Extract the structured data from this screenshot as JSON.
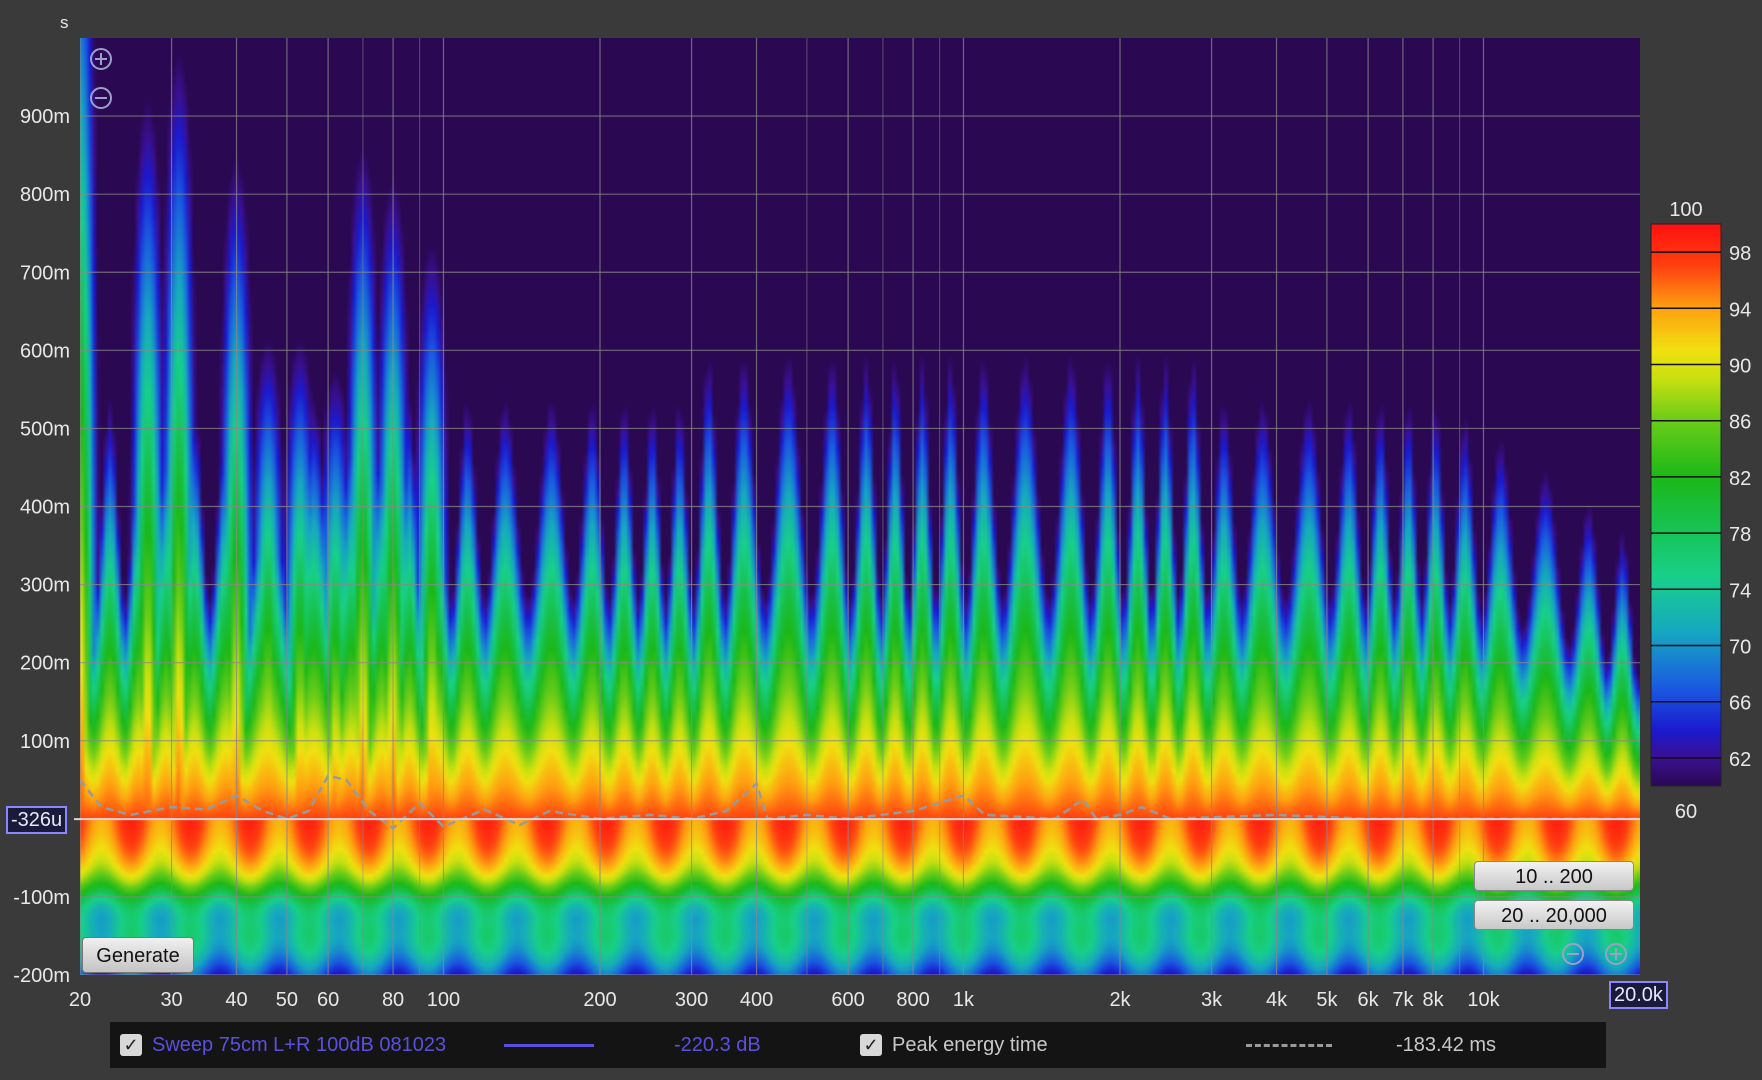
{
  "chart_data": {
    "type": "heatmap",
    "title": "",
    "xlabel": "",
    "ylabel": "s",
    "x_scale": "log",
    "x_range": [
      20,
      20000
    ],
    "y_range": [
      -0.2,
      1.0
    ],
    "x_ticks": [
      {
        "v": 20,
        "label": "20"
      },
      {
        "v": 30,
        "label": "30"
      },
      {
        "v": 40,
        "label": "40"
      },
      {
        "v": 50,
        "label": "50"
      },
      {
        "v": 60,
        "label": "60"
      },
      {
        "v": 80,
        "label": "80"
      },
      {
        "v": 100,
        "label": "100"
      },
      {
        "v": 200,
        "label": "200"
      },
      {
        "v": 300,
        "label": "300"
      },
      {
        "v": 400,
        "label": "400"
      },
      {
        "v": 600,
        "label": "600"
      },
      {
        "v": 800,
        "label": "800"
      },
      {
        "v": 1000,
        "label": "1k"
      },
      {
        "v": 2000,
        "label": "2k"
      },
      {
        "v": 3000,
        "label": "3k"
      },
      {
        "v": 4000,
        "label": "4k"
      },
      {
        "v": 5000,
        "label": "5k"
      },
      {
        "v": 6000,
        "label": "6k"
      },
      {
        "v": 7000,
        "label": "7k"
      },
      {
        "v": 8000,
        "label": "8k"
      },
      {
        "v": 10000,
        "label": "10k"
      }
    ],
    "x_minor_grid": [
      70,
      90,
      500,
      700,
      900,
      9000
    ],
    "x_end_label": "20.0k",
    "y_ticks": [
      {
        "v": 0.9,
        "label": "900m"
      },
      {
        "v": 0.8,
        "label": "800m"
      },
      {
        "v": 0.7,
        "label": "700m"
      },
      {
        "v": 0.6,
        "label": "600m"
      },
      {
        "v": 0.5,
        "label": "500m"
      },
      {
        "v": 0.4,
        "label": "400m"
      },
      {
        "v": 0.3,
        "label": "300m"
      },
      {
        "v": 0.2,
        "label": "200m"
      },
      {
        "v": 0.1,
        "label": "100m"
      },
      {
        "v": -0.1,
        "label": "-100m"
      },
      {
        "v": -0.2,
        "label": "-200m"
      }
    ],
    "cursor": {
      "y": -0.000326,
      "label": "-326u"
    },
    "colorscale": {
      "min": 60,
      "max": 100,
      "min_label": "60",
      "max_label": "100",
      "ticks": [
        98,
        94,
        90,
        86,
        82,
        78,
        74,
        70,
        66,
        62
      ],
      "colors": [
        {
          "v": 60,
          "c": "#2a0852"
        },
        {
          "v": 62,
          "c": "#3a1090"
        },
        {
          "v": 64,
          "c": "#1a1ad0"
        },
        {
          "v": 67,
          "c": "#1a5ae0"
        },
        {
          "v": 71,
          "c": "#16a8c0"
        },
        {
          "v": 75,
          "c": "#18d088"
        },
        {
          "v": 79,
          "c": "#18c048"
        },
        {
          "v": 82,
          "c": "#1cb818"
        },
        {
          "v": 86,
          "c": "#6acc18"
        },
        {
          "v": 89,
          "c": "#c8e010"
        },
        {
          "v": 91,
          "c": "#f0e010"
        },
        {
          "v": 94,
          "c": "#ffa010"
        },
        {
          "v": 97,
          "c": "#ff4010"
        },
        {
          "v": 100,
          "c": "#ff1010"
        }
      ]
    },
    "peak_energy_time": [
      [
        20,
        0.05
      ],
      [
        22,
        0.015
      ],
      [
        25,
        0.005
      ],
      [
        30,
        0.015
      ],
      [
        35,
        0.012
      ],
      [
        40,
        0.03
      ],
      [
        45,
        0.01
      ],
      [
        50,
        0.0
      ],
      [
        55,
        0.01
      ],
      [
        60,
        0.055
      ],
      [
        65,
        0.05
      ],
      [
        72,
        0.01
      ],
      [
        80,
        -0.012
      ],
      [
        90,
        0.02
      ],
      [
        100,
        -0.01
      ],
      [
        120,
        0.012
      ],
      [
        140,
        -0.008
      ],
      [
        160,
        0.01
      ],
      [
        200,
        0.0
      ],
      [
        250,
        0.005
      ],
      [
        300,
        0.0
      ],
      [
        350,
        0.01
      ],
      [
        400,
        0.045
      ],
      [
        420,
        0.0
      ],
      [
        500,
        0.005
      ],
      [
        600,
        0.0
      ],
      [
        800,
        0.01
      ],
      [
        1000,
        0.03
      ],
      [
        1100,
        0.005
      ],
      [
        1500,
        0.0
      ],
      [
        1700,
        0.025
      ],
      [
        1800,
        0.0
      ],
      [
        2000,
        0.005
      ],
      [
        2200,
        0.015
      ],
      [
        2500,
        0.0
      ],
      [
        4000,
        0.005
      ],
      [
        6000,
        0.0
      ],
      [
        10000,
        0.0
      ],
      [
        20000,
        0.0
      ]
    ]
  },
  "controls": {
    "generate_label": "Generate",
    "range_y_label": "10 .. 200",
    "range_x_label": "20 .. 20,000"
  },
  "legend": {
    "items": [
      {
        "checked": true,
        "name": "Sweep 75cm L+R 100dB 081023",
        "value": "-220.3 dB",
        "color": "#5a50e0"
      },
      {
        "checked": true,
        "name": "Peak energy time",
        "value": "-183.42 ms",
        "color": "#9a9a9a"
      }
    ]
  },
  "colors": {
    "background": "#3a3a3a",
    "plot_background": "#2a0852",
    "grid": "#888888",
    "series_blue": "#5a50e0",
    "peak_line": "#9a9a9a",
    "badge_border": "#8a86ff"
  }
}
